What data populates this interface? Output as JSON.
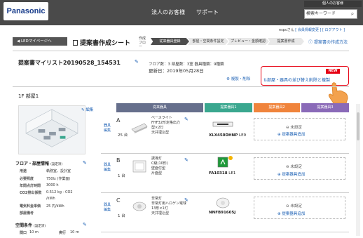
{
  "header": {
    "logo": "Panasonic",
    "nav": [
      "法人のお客様",
      "サポート"
    ],
    "top_link": "個人のお客様",
    "search_placeholder": "検索キーワード",
    "search_icon": "search-icon"
  },
  "user": {
    "name": "nspcさん",
    "links": "[ 会員情報変更 ] [ ログアウト ]"
  },
  "toolbar": {
    "back_label": "LEDマイページへ",
    "page_title": "提案書作成シート",
    "flow_label": "作成フロー",
    "steps": [
      "従来器具登録",
      "部屋・空間条件設定",
      "プレビュー・金額確認",
      "提案書作成"
    ],
    "active_step": 0,
    "help_link": "提案書の作成方法"
  },
  "list": {
    "name": "提案書マイリスト20190528_154531",
    "meta_line": "フロア数：3  部屋数：3室  器具種類：9種類",
    "updated_label": "更新日：",
    "updated_date": "2019年05月28日",
    "copy_delete": "複製・削除",
    "sort_link": "部屋・器具の並び替え削除と複製",
    "new_badge": "NEW"
  },
  "floor": {
    "label": "1F 部屋1",
    "edit_label": "編集",
    "columns": [
      "従来器具",
      "提案器具1",
      "提案器具2",
      "提案器具3"
    ],
    "column_colors": [
      "#666f8c",
      "#3aa78f",
      "#f0843c",
      "#8a6ab8"
    ],
    "room_info_title": "フロア・部屋情報",
    "room_info_sub": "(設定済)",
    "room_info": [
      {
        "k": "用途",
        "v": "執務室、設計室"
      },
      {
        "k": "必要照度",
        "v": "750lx (作業面)"
      },
      {
        "k": "年間点灯時間",
        "v": "3000 h"
      },
      {
        "k": "CO2排出係数",
        "v": "0.512 kg - CO2"
      },
      {
        "k": "",
        "v": "/kWh"
      },
      {
        "k": "電気料金単価",
        "v": "25 円/kWh"
      },
      {
        "k": "部屋備考",
        "v": ""
      }
    ],
    "space_title": "空間条件",
    "space_sub": "(設定済)",
    "space": [
      {
        "k": "間口",
        "v": "10 m",
        "k2": "奥行",
        "v2": "10 m"
      }
    ]
  },
  "rows": [
    {
      "letter": "A",
      "qty": "25 台",
      "edit": "器具編集",
      "desc": [
        "ベースライト",
        "FHF32形定格出力",
        "型×2灯",
        "天井埋込型"
      ],
      "code": "XLX450DHNP",
      "code_sub": "LE9",
      "unset": "未設定",
      "add": "提案器具追加"
    },
    {
      "letter": "B",
      "qty": "1 台",
      "edit": "器具編集",
      "desc": [
        "誘導灯",
        "C級(10形)",
        "壁面付型",
        "片面型"
      ],
      "code": "FA10318",
      "code_sub": "LE1",
      "unset": "未設定",
      "add": "提案器具追加"
    },
    {
      "letter": "C",
      "qty": "1 台",
      "edit": "器具編集",
      "desc": [
        "非常灯",
        "非常灯用ハロゲン電球",
        "13形×1灯",
        "天井埋込型"
      ],
      "code": "NNFB91605J",
      "code_sub": "",
      "unset": "未設定",
      "add": "提案器具追加"
    }
  ]
}
